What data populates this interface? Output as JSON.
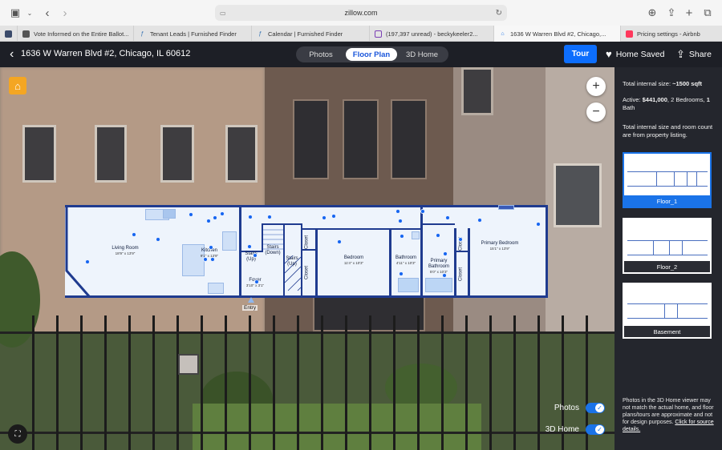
{
  "browser": {
    "url": "zillow.com",
    "tabs": [
      {
        "label": "Vote Informed on the Entire Ballot...",
        "favicon_color": "#555"
      },
      {
        "label": "Tenant Leads | Furnished Finder",
        "favicon_color": "#2b6cb0"
      },
      {
        "label": "Calendar | Furnished Finder",
        "favicon_color": "#2b6cb0"
      },
      {
        "label": "(197,397 unread) - beckykeeler2...",
        "favicon_color": "#7b3fb5"
      },
      {
        "label": "1636 W Warren Blvd #2, Chicago,...",
        "favicon_color": "#1a73e8"
      },
      {
        "label": "Pricing settings - Airbnb",
        "favicon_color": "#ff385c"
      }
    ]
  },
  "header": {
    "address": "1636 W Warren Blvd #2, Chicago, IL 60612",
    "view_tabs": [
      "Photos",
      "Floor Plan",
      "3D Home"
    ],
    "active_view": "Floor Plan",
    "tour_label": "Tour",
    "home_saved_label": "Home Saved",
    "share_label": "Share"
  },
  "floorplan": {
    "rooms": [
      {
        "name": "Living Room",
        "dim": "18'9\" x 13'9\""
      },
      {
        "name": "Kitchen",
        "dim": "9'1\" x 13'9\""
      },
      {
        "name": "Stairs\n(Up)",
        "dim": ""
      },
      {
        "name": "Stairs\n(Down)",
        "dim": ""
      },
      {
        "name": "Stairs\n(Up)",
        "dim": ""
      },
      {
        "name": "Foyer",
        "dim": "3'10\" x 3'1\""
      },
      {
        "name": "Closet",
        "dim": ""
      },
      {
        "name": "Closet",
        "dim": ""
      },
      {
        "name": "Bedroom",
        "dim": "11'4\" x 10'3\""
      },
      {
        "name": "Bathroom",
        "dim": "4'11\" x 10'3\""
      },
      {
        "name": "Primary\nBathroom",
        "dim": "5'0\" x 10'3\""
      },
      {
        "name": "Closet",
        "dim": ""
      },
      {
        "name": "Closet",
        "dim": ""
      },
      {
        "name": "Primary Bedroom",
        "dim": "15'1\" x 13'9\""
      }
    ],
    "entry_label": "Entry"
  },
  "toggles": {
    "photos_label": "Photos",
    "photos_on": true,
    "home3d_label": "3D Home",
    "home3d_on": true
  },
  "sidebar": {
    "total_size_label": "Total internal size:",
    "total_size_value": "~1500 sqft",
    "active_label": "Active:",
    "active_price": "$441,000",
    "active_beds": "2 Bedrooms,",
    "active_bath_count": "1",
    "active_bath_label": "Bath",
    "note": "Total internal size and room count are from property listing.",
    "floors": [
      "Floor_1",
      "Floor_2",
      "Basement"
    ],
    "active_floor": "Floor_1",
    "footer_text": "Photos in the 3D Home viewer may not match the actual home, and floor plans/tours are approximate and not for design purposes.",
    "footer_link": "Click for source details."
  },
  "colors": {
    "accent": "#1a73e8",
    "header_bg": "#1d1f26",
    "sidebar_bg": "#24262d",
    "plan_wall": "#1f3b8f",
    "pin": "#1565f0"
  },
  "icons": {
    "logo": "zillow-logo-icon",
    "zoom_in": "plus-icon",
    "zoom_out": "minus-icon",
    "heart": "heart-icon",
    "share": "share-icon",
    "fullscreen": "expand-icon"
  }
}
